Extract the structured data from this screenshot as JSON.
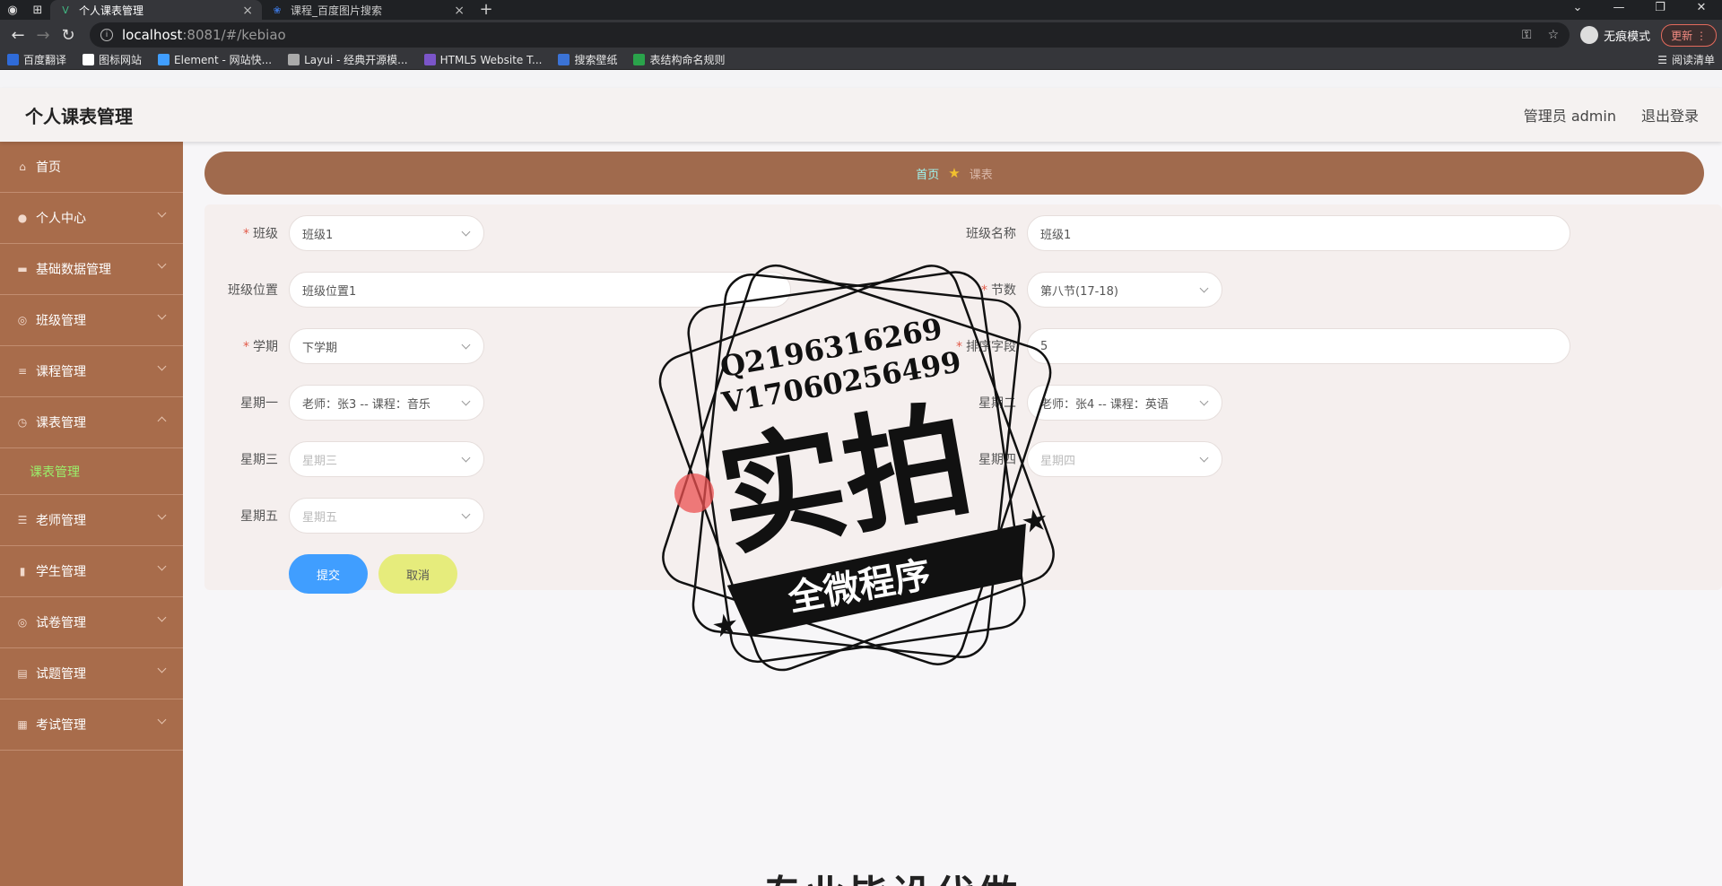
{
  "browser": {
    "tabs": [
      {
        "label": "个人课表管理",
        "active": true
      },
      {
        "label": "课程_百度图片搜索",
        "active": false
      }
    ],
    "url_host": "localhost",
    "url_path": ":8081/#/kebiao",
    "incognito_label": "无痕模式",
    "update_label": "更新",
    "bookmarks": [
      {
        "label": "百度翻译",
        "color": "#2f6bd8"
      },
      {
        "label": "图标网站",
        "color": "#333"
      },
      {
        "label": "Element - 网站快...",
        "color": "#409eff"
      },
      {
        "label": "Layui - 经典开源模...",
        "color": "#666"
      },
      {
        "label": "HTML5 Website T...",
        "color": "#7b55c9"
      },
      {
        "label": "搜索壁纸",
        "color": "#3b73d6"
      },
      {
        "label": "表结构命名规则",
        "color": "#2aa34b"
      }
    ],
    "reading_list": "阅读清单"
  },
  "header": {
    "title": "个人课表管理",
    "user": "管理员 admin",
    "logout": "退出登录"
  },
  "sidebar": {
    "items": [
      {
        "label": "首页",
        "icon": "home-icon"
      },
      {
        "label": "个人中心",
        "icon": "user-icon"
      },
      {
        "label": "基础数据管理",
        "icon": "monitor-icon"
      },
      {
        "label": "班级管理",
        "icon": "globe-icon"
      },
      {
        "label": "课程管理",
        "icon": "sliders-icon"
      },
      {
        "label": "课表管理",
        "icon": "clock-icon",
        "expanded": true
      },
      {
        "label": "老师管理",
        "icon": "list-icon"
      },
      {
        "label": "学生管理",
        "icon": "chart-icon"
      },
      {
        "label": "试卷管理",
        "icon": "globe-icon"
      },
      {
        "label": "试题管理",
        "icon": "box-icon"
      },
      {
        "label": "考试管理",
        "icon": "grid-icon"
      }
    ],
    "submenu": {
      "label": "课表管理"
    }
  },
  "breadcrumb": {
    "home": "首页",
    "current": "课表"
  },
  "form": {
    "class": {
      "label": "班级",
      "value": "班级1"
    },
    "class_name": {
      "label": "班级名称",
      "value": "班级1"
    },
    "class_location": {
      "label": "班级位置",
      "value": "班级位置1"
    },
    "section": {
      "label": "节数",
      "value": "第八节(17-18)"
    },
    "semester": {
      "label": "学期",
      "value": "下学期"
    },
    "sort_field": {
      "label": "排序字段",
      "value": "5"
    },
    "monday": {
      "label": "星期一",
      "value": "老师：张3 -- 课程：音乐"
    },
    "tuesday": {
      "label": "星期二",
      "value": "老师：张4 -- 课程：英语"
    },
    "wednesday": {
      "label": "星期三",
      "placeholder": "星期三"
    },
    "thursday": {
      "label": "星期四",
      "placeholder": "星期四"
    },
    "friday": {
      "label": "星期五",
      "placeholder": "星期五"
    },
    "submit": "提交",
    "cancel": "取消"
  },
  "watermark": {
    "line1": "Q2196316269",
    "line2": "V17060256499",
    "big": "实拍",
    "banner": "全微程序"
  },
  "bottom_text": "专业毕设代做"
}
